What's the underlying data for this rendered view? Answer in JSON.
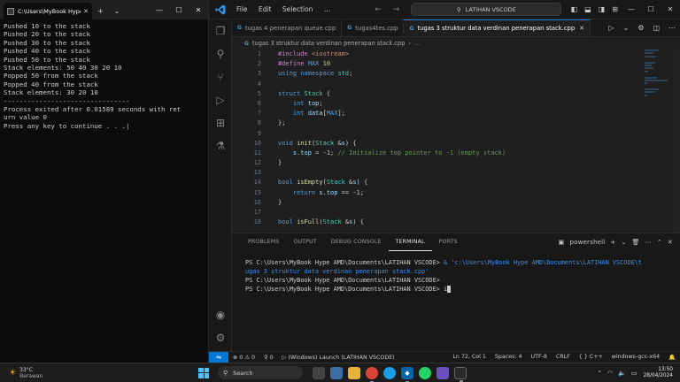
{
  "console": {
    "tab_title": "C:\\Users\\MyBook Hype A",
    "lines": [
      "Pushed 10 to the stack",
      "Pushed 20 to the stack",
      "Pushed 30 to the stack",
      "Pushed 40 to the stack",
      "Pushed 50 to the stack",
      "Stack elements: 50 40 30 20 10",
      "Popped 50 from the stack",
      "Popped 40 from the stack",
      "Stack elements: 30 20 10",
      "",
      "--------------------------------",
      "Process exited after 0.01589 seconds with ret",
      "urn value 0",
      "Press any key to continue . . ."
    ]
  },
  "vscode": {
    "menu": [
      "File",
      "Edit",
      "Selection",
      "…"
    ],
    "command_center": "LATIHAN VSCODE",
    "tabs": [
      {
        "label": "tugas 4 penerapan queue.cpp",
        "active": false
      },
      {
        "label": "tugas4tes.cpp",
        "active": false
      },
      {
        "label": "tugas 3 struktur data verdinan penerapan stack.cpp",
        "active": true
      }
    ],
    "breadcrumb": "tugas 3 struktur data verdinan penerapan stack.cpp",
    "code_lines": [
      {
        "n": "1",
        "text": "#include <iostream>"
      },
      {
        "n": "2",
        "text": "#define MAX 10"
      },
      {
        "n": "3",
        "text": "using namespace std;"
      },
      {
        "n": "4",
        "text": ""
      },
      {
        "n": "5",
        "text": "struct Stack {"
      },
      {
        "n": "6",
        "text": "    int top;"
      },
      {
        "n": "7",
        "text": "    int data[MAX];"
      },
      {
        "n": "8",
        "text": "};"
      },
      {
        "n": "9",
        "text": ""
      },
      {
        "n": "10",
        "text": "void init(Stack &s) {"
      },
      {
        "n": "11",
        "text": "    s.top = -1; // Initialize top pointer to -1 (empty stack)"
      },
      {
        "n": "12",
        "text": "}"
      },
      {
        "n": "13",
        "text": ""
      },
      {
        "n": "14",
        "text": "bool isEmpty(Stack &s) {"
      },
      {
        "n": "15",
        "text": "    return s.top == -1;"
      },
      {
        "n": "16",
        "text": "}"
      },
      {
        "n": "17",
        "text": ""
      },
      {
        "n": "18",
        "text": "bool isFull(Stack &s) {"
      }
    ],
    "panel_tabs": [
      "PROBLEMS",
      "OUTPUT",
      "DEBUG CONSOLE",
      "TERMINAL",
      "PORTS"
    ],
    "active_panel_tab": "TERMINAL",
    "terminal_profile": "powershell",
    "terminal": {
      "prompt1": "PS C:\\Users\\MyBook Hype AMD\\Documents\\LATIHAN VSCODE> ",
      "cmd1": "& 'c:\\Users\\MyBook Hype AMD\\Documents\\LATIHAN VSCODE\\t",
      "cmd1_cont": "ugas 3 struktur data verdinan penerapan stack.cpp'",
      "prompt2": "PS C:\\Users\\MyBook Hype AMD\\Documents\\LATIHAN VSCODE>",
      "prompt3": "PS C:\\Users\\MyBook Hype AMD\\Documents\\LATIHAN VSCODE> ",
      "typed": "i"
    },
    "status": {
      "errors": "0",
      "warnings": "0",
      "ports": "0",
      "launch": "(Windows) Launch (LATIHAN VSCODE)",
      "position": "Ln 72, Col 1",
      "spaces": "Spaces: 4",
      "encoding": "UTF-8",
      "eol": "CRLF",
      "language": "C++",
      "config": "windows-gcc-x64"
    }
  },
  "taskbar": {
    "temperature": "33°C",
    "condition": "Berawan",
    "search_placeholder": "Search",
    "time": "13:50",
    "date": "28/04/2024"
  },
  "colors": {
    "accent": "#0078d4",
    "console_bg": "#0c0c0c",
    "editor_bg": "#1f1f1f"
  }
}
